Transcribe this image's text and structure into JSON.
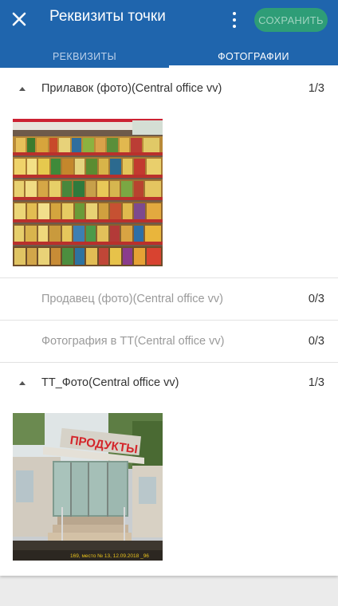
{
  "appbar": {
    "title": "Реквизиты точки",
    "save_label": "СОХРАНИТЬ",
    "icons": {
      "close": "close-icon",
      "menu": "more-vert-icon"
    },
    "colors": {
      "bar": "#1f65ad",
      "save": "#2e9d77"
    }
  },
  "tabs": [
    {
      "label": "РЕКВИЗИТЫ",
      "active": false
    },
    {
      "label": "ФОТОГРАФИИ",
      "active": true
    }
  ],
  "sections": [
    {
      "title": "Прилавок (фото)(Central office vv)",
      "count": "1/3",
      "expanded": true,
      "enabled": true,
      "photo": "store-shelves-photo"
    },
    {
      "title": "Продавец (фото)(Central office vv)",
      "count": "0/3",
      "expanded": false,
      "enabled": false
    },
    {
      "title": "Фотография в ТТ(Central office vv)",
      "count": "0/3",
      "expanded": false,
      "enabled": false
    },
    {
      "title": "ТТ_Фото(Central office vv)",
      "count": "1/3",
      "expanded": true,
      "enabled": true,
      "photo": "storefront-photo",
      "photo_caption": "169, место № 13, 12.09.2018 _96"
    }
  ],
  "storefront_sign": "ПРОДУКТЫ"
}
